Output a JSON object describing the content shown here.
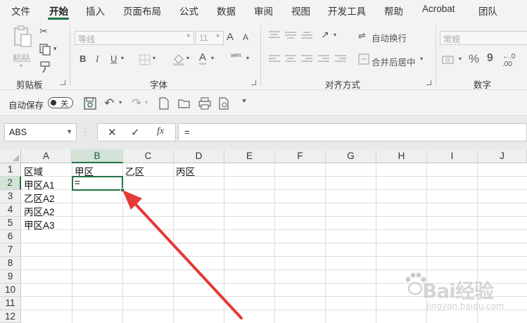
{
  "tabs": [
    {
      "label": "文件",
      "active": false
    },
    {
      "label": "开始",
      "active": true
    },
    {
      "label": "插入",
      "active": false
    },
    {
      "label": "页面布局",
      "active": false
    },
    {
      "label": "公式",
      "active": false
    },
    {
      "label": "数据",
      "active": false
    },
    {
      "label": "审阅",
      "active": false
    },
    {
      "label": "视图",
      "active": false
    },
    {
      "label": "开发工具",
      "active": false
    },
    {
      "label": "帮助",
      "active": false
    },
    {
      "label": "Acrobat",
      "active": false
    },
    {
      "label": "团队",
      "active": false
    }
  ],
  "ribbon": {
    "clipboard": {
      "paste_label": "粘贴",
      "group_label": "剪贴板"
    },
    "font": {
      "font_name": "等线",
      "font_size": "11",
      "increase": "A",
      "decrease": "A",
      "bold": "B",
      "italic": "I",
      "underline": "U",
      "phonetic": "wén",
      "font_color_glyph": "A",
      "group_label": "字体"
    },
    "alignment": {
      "wrap_text": "自动换行",
      "merge_center": "合并后居中",
      "group_label": "对齐方式"
    },
    "number": {
      "format": "常规",
      "percent": "%",
      "comma": "9",
      "group_label": "数字"
    }
  },
  "quick_access": {
    "autosave_label": "自动保存",
    "autosave_state": "关"
  },
  "formula_bar": {
    "name_box": "ABS",
    "cancel": "✕",
    "enter": "✓",
    "function": "fx",
    "content": "="
  },
  "grid": {
    "columns": [
      "A",
      "B",
      "C",
      "D",
      "E",
      "F",
      "G",
      "H",
      "I",
      "J"
    ],
    "rows": [
      "1",
      "2",
      "3",
      "4",
      "5",
      "6",
      "7",
      "8",
      "9",
      "10",
      "11",
      "12"
    ],
    "selected_column": "B",
    "selected_row": "2",
    "cells": {
      "A1": "区域",
      "B1": "甲区",
      "C1": "乙区",
      "D1": "丙区",
      "A2": "甲区A1",
      "B2": "=",
      "A3": "乙区A2",
      "A4": "丙区A2",
      "A5": "甲区A3"
    }
  },
  "watermark": {
    "brand": "Bai经验",
    "sub": "jingyan.baidu.com"
  },
  "colors": {
    "accent": "#217346",
    "arrow": "#e53935"
  }
}
